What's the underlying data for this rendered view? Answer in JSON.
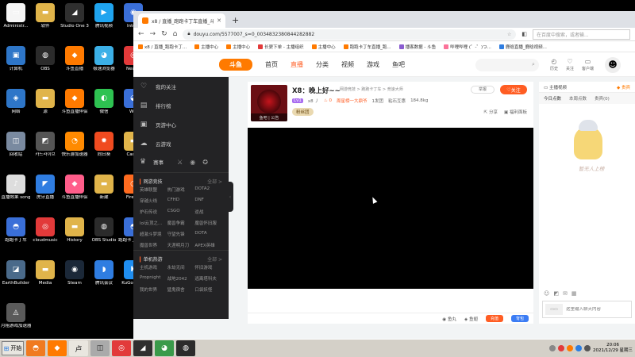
{
  "desktop": {
    "icons": [
      {
        "label": "Administr...",
        "color": "#f5f5f5",
        "glyph": "▭"
      },
      {
        "label": "软件",
        "color": "#e0b44a",
        "glyph": "▬"
      },
      {
        "label": "Studio One 3",
        "color": "#2f2f2f",
        "glyph": "◢"
      },
      {
        "label": "腾讯视频",
        "color": "#1fa4ef",
        "glyph": "▶"
      },
      {
        "label": "Inte...",
        "color": "#3a6fd8",
        "glyph": "◉"
      },
      {
        "label": "计算机",
        "color": "#2e76c8",
        "glyph": "▣"
      },
      {
        "label": "OBS",
        "color": "#2b2b2b",
        "glyph": "◍"
      },
      {
        "label": "斗鱼直播",
        "color": "#ff7a00",
        "glyph": "◆"
      },
      {
        "label": "极速浏览器",
        "color": "#3cb0e7",
        "glyph": "◕"
      },
      {
        "label": "Neur...",
        "color": "#e23a3a",
        "glyph": "◎"
      },
      {
        "label": "网络",
        "color": "#2e76c8",
        "glyph": "◈"
      },
      {
        "label": "源",
        "color": "#e0b44a",
        "glyph": "▬"
      },
      {
        "label": "斗鱼直播伴侣",
        "color": "#ff7a00",
        "glyph": "◆"
      },
      {
        "label": "微信",
        "color": "#2ec251",
        "glyph": "◐"
      },
      {
        "label": "W...",
        "color": "#3a6fd8",
        "glyph": "◒"
      },
      {
        "label": "回收站",
        "color": "#7a8aa0",
        "glyph": "◫"
      },
      {
        "label": "카드라이브",
        "color": "#555",
        "glyph": "◩"
      },
      {
        "label": "快乐游加速器",
        "color": "#ff8a00",
        "glyph": "◔"
      },
      {
        "label": "向日葵",
        "color": "#f04b20",
        "glyph": "✹"
      },
      {
        "label": "Cache",
        "color": "#e0b44a",
        "glyph": "▬"
      },
      {
        "label": "直播效果 song",
        "color": "#ddd",
        "glyph": "♪"
      },
      {
        "label": "虎牙直播",
        "color": "#2f7de1",
        "glyph": "◤"
      },
      {
        "label": "斗鱼直播伴侣",
        "color": "#ff5d8a",
        "glyph": "◆"
      },
      {
        "label": "新建",
        "color": "#e0b44a",
        "glyph": "▬"
      },
      {
        "label": "Firefox",
        "color": "#ff6b1f",
        "glyph": "◑"
      },
      {
        "label": "跑跑卡丁车",
        "color": "#3a6fd8",
        "glyph": "◓"
      },
      {
        "label": "cloudmusic",
        "color": "#e23a3a",
        "glyph": "◎"
      },
      {
        "label": "History",
        "color": "#e0b44a",
        "glyph": "▬"
      },
      {
        "label": "OBS Studio",
        "color": "#2b2b2b",
        "glyph": "◍"
      },
      {
        "label": "跑跑卡丁车 赛事",
        "color": "#3a6fd8",
        "glyph": "◓"
      },
      {
        "label": "EarthBuilder",
        "color": "#4a6a8a",
        "glyph": "◪"
      },
      {
        "label": "Media",
        "color": "#e0b44a",
        "glyph": "▬"
      },
      {
        "label": "Steam",
        "color": "#1b2838",
        "glyph": "◉"
      },
      {
        "label": "腾讯会议",
        "color": "#2f7de1",
        "glyph": "◗"
      },
      {
        "label": "KuGou.exe",
        "color": "#1f8ef0",
        "glyph": "K"
      },
      {
        "label": "月租游戏加速器",
        "color": "#5a5a5a",
        "glyph": "◬"
      }
    ]
  },
  "taskbar": {
    "start_label": "开始",
    "apps": [
      {
        "name": "kart-app",
        "color": "#f07a20",
        "glyph": "◓"
      },
      {
        "name": "douyu-app",
        "color": "#ff7a00",
        "glyph": "◆"
      },
      {
        "name": "folder-app",
        "color": "#e9e6df",
        "glyph": "卢"
      },
      {
        "name": "game-app",
        "color": "#aaa",
        "glyph": "◫"
      },
      {
        "name": "music-app",
        "color": "#e23a3a",
        "glyph": "◎"
      },
      {
        "name": "studio-app",
        "color": "#2f2f2f",
        "glyph": "◢"
      },
      {
        "name": "chrome-app",
        "color": "#3a9a4a",
        "glyph": "◕"
      },
      {
        "name": "obs-app",
        "color": "#2b2b2b",
        "glyph": "◍"
      }
    ],
    "clock_time": "20:06",
    "clock_date": "2021/12/29 星期三"
  },
  "browser": {
    "tab_title": "x8 / 直播_跑跑卡丁车直播_斗鱼...",
    "url": "douyu.com/5577007_s=0_0034832380844282882",
    "search_placeholder": "在百度中搜索，或者输...",
    "bookmarks": [
      {
        "label": "x8 / 直播_跑跑卡丁...",
        "color": "#ff7a00"
      },
      {
        "label": "主播中心",
        "color": "#ff7a00"
      },
      {
        "label": "主播中心",
        "color": "#ff7a00"
      },
      {
        "label": "长更下单 - 主播组织",
        "color": "#e23a3a"
      },
      {
        "label": "主播中心",
        "color": "#ff7a00"
      },
      {
        "label": "跑跑卡丁车直播_跑...",
        "color": "#ff7a00"
      },
      {
        "label": "播客数据 - 斗鱼",
        "color": "#8a5cd0"
      },
      {
        "label": "哔哩哔哩 (゜-゜)つ...",
        "color": "#fb7299"
      },
      {
        "label": "鹿晗直播_鹿晗视频...",
        "color": "#2f7de1"
      }
    ]
  },
  "site": {
    "logo_text": "斗鱼",
    "nav": [
      "首页",
      "直播",
      "分类",
      "视频",
      "游戏",
      "鱼吧"
    ],
    "header_icons": [
      {
        "glyph": "◴",
        "label": "历史"
      },
      {
        "glyph": "♡",
        "label": "关注"
      },
      {
        "glyph": "▭",
        "label": "客户端"
      }
    ]
  },
  "sidebar": {
    "items": [
      {
        "icon": "♡",
        "label": "我的关注"
      },
      {
        "icon": "▤",
        "label": "排行榜"
      },
      {
        "icon": "▣",
        "label": "页游中心"
      },
      {
        "icon": "☁",
        "label": "云游戏"
      }
    ],
    "match_label": "赛事",
    "sections": [
      {
        "title": "网游竞技",
        "more": "全部 >",
        "cats": [
          "英雄联盟",
          "热门游戏",
          "DOTA2",
          "穿越火线",
          "CFHD",
          "DNF",
          "炉石传说",
          "CSGO",
          "逆战",
          "lol云顶之...",
          "魔兽争霸",
          "魔兽怀旧服",
          "超激斗梦境",
          "守望先锋",
          "DOTA",
          "魔兽世界",
          "天涯明月刀",
          "APEX英雄"
        ]
      },
      {
        "title": "单机热游",
        "more": "全部 >",
        "cats": [
          "主机游戏",
          "永劫无间",
          "怀旧游戏",
          "Propnight",
          "战地2042",
          "逃离塔科夫",
          "我的世界",
          "猛鬼宿舍",
          "口袋妖怪"
        ]
      }
    ]
  },
  "room": {
    "title": "X8：晚上好~~",
    "avatar_caption": "鱼吧 | 公告",
    "level": "Lv1",
    "anchor_name": "x8 丿",
    "hot": "0",
    "rank": "周星榜一大鼎爷",
    "report_label": "举报",
    "category": "网游竞技 > 跑跑卡丁车 > 竞速大师",
    "fans": "1发团",
    "fanclub": "粘石互惠",
    "weight": "184.8kg",
    "tag": "粉丝团",
    "follow_label": "关注",
    "share_label": "分享",
    "welfare_label": "福利面板",
    "gift_bar": {
      "fishball": "鱼丸",
      "fishwing": "鱼翅",
      "recharge": "充值",
      "backpack": "背包"
    }
  },
  "chat": {
    "rank_title": "主播视频",
    "rank_switch": "贵宾",
    "tabs": [
      "今日点数",
      "本周点数",
      "贵宾(0)"
    ],
    "empty_text": "暂无人上榜",
    "tools": [
      "☺",
      "◩",
      "✉",
      "▦"
    ],
    "input_placeholder": "这里输入聊天内容",
    "input_left_label": "▭▭"
  }
}
